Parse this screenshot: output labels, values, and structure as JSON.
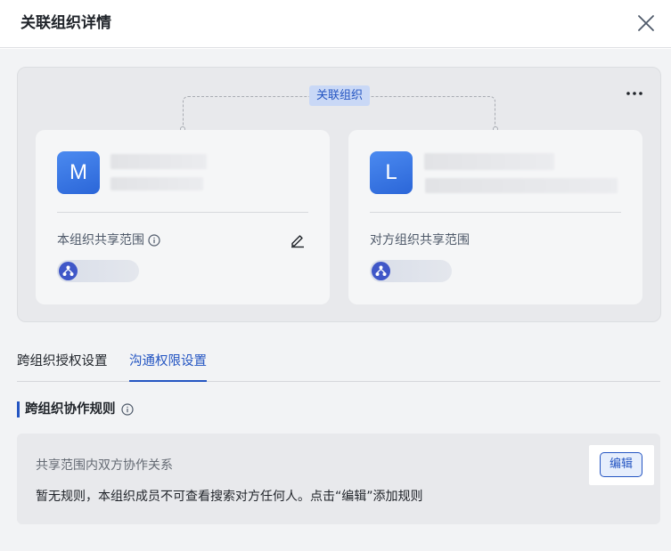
{
  "dialog": {
    "title": "关联组织详情"
  },
  "relation": {
    "tag_label": "关联组织",
    "left_org": {
      "avatar_letter": "M",
      "scope_label": "本组织共享范围"
    },
    "right_org": {
      "avatar_letter": "L",
      "scope_label": "对方组织共享范围"
    }
  },
  "tabs": [
    {
      "label": "跨组织授权设置",
      "active": false
    },
    {
      "label": "沟通权限设置",
      "active": true
    }
  ],
  "section": {
    "title": "跨组织协作规则"
  },
  "rule": {
    "title": "共享范围内双方协作关系",
    "description": "暂无规则，本组织成员不可查看搜索对方任何人。点击“编辑”添加规则",
    "edit_label": "编辑"
  },
  "colors": {
    "accent": "#2455c2",
    "avatar": "#3b7be8"
  }
}
